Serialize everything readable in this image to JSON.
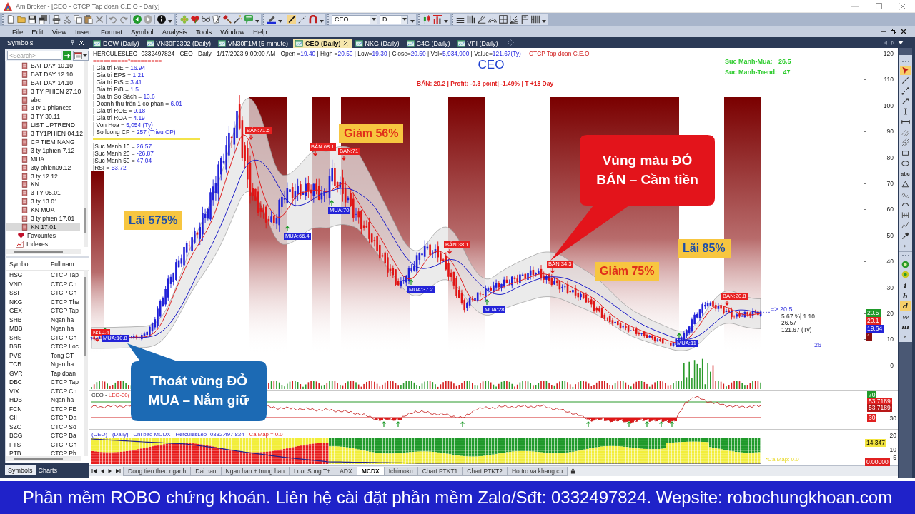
{
  "window": {
    "title": "AmiBroker - [CEO - CTCP Tap doan C.E.O - Daily]"
  },
  "toolbar": {
    "symbol_combo": "CEO",
    "interval_combo": "D"
  },
  "menu": [
    "File",
    "Edit",
    "View",
    "Insert",
    "Format",
    "Symbol",
    "Analysis",
    "Tools",
    "Window",
    "Help"
  ],
  "symbols_panel": {
    "title": "Symbols",
    "search": {
      "placeholder": "<Search>"
    },
    "tree": [
      {
        "label": "BAT DAY 10.10",
        "kind": "watchlist",
        "selected": false
      },
      {
        "label": "BAT DAY 12.10",
        "kind": "watchlist",
        "selected": false
      },
      {
        "label": "BAT DAY 14.10",
        "kind": "watchlist",
        "selected": false
      },
      {
        "label": "3 TY PHIEN 27.10",
        "kind": "watchlist",
        "selected": false
      },
      {
        "label": "abc",
        "kind": "watchlist",
        "selected": false
      },
      {
        "label": "3 ty 1 phienccc",
        "kind": "watchlist",
        "selected": false
      },
      {
        "label": "3 TY 30.11",
        "kind": "watchlist",
        "selected": false
      },
      {
        "label": "LIST UPTREND",
        "kind": "watchlist",
        "selected": false
      },
      {
        "label": "3 TY1PHIEN 04.12",
        "kind": "watchlist",
        "selected": false
      },
      {
        "label": "CP TIEM NANG",
        "kind": "watchlist",
        "selected": false
      },
      {
        "label": "3 ty 1phien 7.12",
        "kind": "watchlist",
        "selected": false
      },
      {
        "label": "MUA",
        "kind": "watchlist",
        "selected": false
      },
      {
        "label": "3ty phien09.12",
        "kind": "watchlist",
        "selected": false
      },
      {
        "label": "3 ty 12.12",
        "kind": "watchlist",
        "selected": false
      },
      {
        "label": "KN",
        "kind": "watchlist",
        "selected": false
      },
      {
        "label": "3 TY 05.01",
        "kind": "watchlist",
        "selected": false
      },
      {
        "label": "3 ty 13.01",
        "kind": "watchlist",
        "selected": false
      },
      {
        "label": "KN MUA",
        "kind": "watchlist",
        "selected": false
      },
      {
        "label": "3 ty phien 17.01",
        "kind": "watchlist",
        "selected": false
      },
      {
        "label": "KN 17.01",
        "kind": "watchlist",
        "selected": true
      },
      {
        "label": "Favourites",
        "kind": "favourites",
        "selected": false
      },
      {
        "label": "Indexes",
        "kind": "indexes",
        "selected": false
      }
    ],
    "table": {
      "columns": [
        "Symbol",
        "Full nam"
      ],
      "rows": [
        [
          "HSG",
          "CTCP Tap"
        ],
        [
          "VND",
          "CTCP Ch"
        ],
        [
          "SSI",
          "CTCP Ch"
        ],
        [
          "NKG",
          "CTCP The"
        ],
        [
          "GEX",
          "CTCP Tap"
        ],
        [
          "SHB",
          "Ngan ha"
        ],
        [
          "MBB",
          "Ngan ha"
        ],
        [
          "SHS",
          "CTCP Ch"
        ],
        [
          "BSR",
          "CTCP Loc"
        ],
        [
          "PVS",
          "Tong CT"
        ],
        [
          "TCB",
          "Ngan ha"
        ],
        [
          "GVR",
          "Tap doan"
        ],
        [
          "DBC",
          "CTCP Tap"
        ],
        [
          "VIX",
          "CTCP Ch"
        ],
        [
          "HDB",
          "Ngan ha"
        ],
        [
          "FCN",
          "CTCP FE"
        ],
        [
          "CII",
          "CTCP Da"
        ],
        [
          "SZC",
          "CTCP So"
        ],
        [
          "BCG",
          "CTCP Ba"
        ],
        [
          "FTS",
          "CTCP Ch"
        ],
        [
          "PTB",
          "CTCP Ph"
        ]
      ]
    },
    "tabs": [
      {
        "label": "Symbols",
        "selected": true
      },
      {
        "label": "Charts",
        "selected": false
      }
    ]
  },
  "chart_tabs": [
    {
      "label": "DGW (Daily)",
      "selected": false
    },
    {
      "label": "VN30F2302 (Daily)",
      "selected": false
    },
    {
      "label": "VN30F1M (5-minute)",
      "selected": false
    },
    {
      "label": "CEO (Daily)",
      "selected": true
    },
    {
      "label": "NKG (Daily)",
      "selected": false
    },
    {
      "label": "C4G (Daily)",
      "selected": false
    },
    {
      "label": "VPI (Daily)",
      "selected": false
    }
  ],
  "price_chart": {
    "header": [
      {
        "text": "HERCULESLEO -0332497824 - CEO - Daily - 1/17/2023 9:00:00 AM - Open =",
        "kind": "label"
      },
      {
        "text": "19.40",
        "kind": "value"
      },
      {
        "text": " | High =",
        "kind": "label"
      },
      {
        "text": "20.50",
        "kind": "value"
      },
      {
        "text": " | Low=",
        "kind": "label"
      },
      {
        "text": "19.30",
        "kind": "value"
      },
      {
        "text": " | Close=",
        "kind": "label"
      },
      {
        "text": "20.50",
        "kind": "value"
      },
      {
        "text": " | Vol=",
        "kind": "label"
      },
      {
        "text": "5,934,900",
        "kind": "value"
      },
      {
        "text": " | Value=",
        "kind": "label"
      },
      {
        "text": "121.67(Ty)",
        "kind": "value"
      },
      {
        "text": "----CTCP Tap doan C.E.O----",
        "kind": "name"
      }
    ],
    "separator": "==========*=========",
    "fundamentals": [
      {
        "label": "| Gia tri P/E = ",
        "value": "16.94"
      },
      {
        "label": "| Gia tri EPS = ",
        "value": "1.21"
      },
      {
        "label": "| Gia tri P/S = ",
        "value": "3.41"
      },
      {
        "label": "| Gia tri P/B = ",
        "value": "1.5"
      },
      {
        "label": "| Gia tri So Sách = ",
        "value": "13.6"
      },
      {
        "label": "| Doanh thu trên 1 co phan = ",
        "value": "6.01"
      },
      {
        "label": "| Gia tri ROE = ",
        "value": "9.18"
      },
      {
        "label": "| Gia tri ROA = ",
        "value": "4.19"
      },
      {
        "label": "| Von Hoa = ",
        "value": "5,054 (Ty)"
      },
      {
        "label": "| So luong CP = ",
        "value": "257 (Trieu CP)"
      }
    ],
    "strength": [
      {
        "label": "|Suc Manh 10 = ",
        "value": "26.57"
      },
      {
        "label": "|Suc Manh 20 = ",
        "value": "-26.87"
      },
      {
        "label": "|Suc Manh 50 = ",
        "value": "47.04"
      },
      {
        "label": "|RSI = ",
        "value": "53.72"
      }
    ],
    "title": "CEO",
    "trade_line": "BÁN: 20.2 | Profit: -0.3 point| -1.49% | T +18 Day",
    "summary": [
      {
        "label": "Suc Manh-Mua:",
        "value": "26.5"
      },
      {
        "label": "Suc Manh-Trend:",
        "value": "47"
      }
    ],
    "signals": [
      {
        "text": "N:10.4",
        "kind": "sell"
      },
      {
        "text": "MUA:10.8",
        "kind": "buy"
      },
      {
        "text": "BÁN:71.5",
        "kind": "sell"
      },
      {
        "text": "MUA:66.4",
        "kind": "buy"
      },
      {
        "text": "BÁN:68.1",
        "kind": "sell"
      },
      {
        "text": "MUA:70",
        "kind": "buy"
      },
      {
        "text": "BÁN:71",
        "kind": "sell"
      },
      {
        "text": "MUA:37.2",
        "kind": "buy"
      },
      {
        "text": "BÁN:38.1",
        "kind": "sell"
      },
      {
        "text": "MUA:28",
        "kind": "buy"
      },
      {
        "text": "BÁN:34.3",
        "kind": "sell"
      },
      {
        "text": "MUA:11",
        "kind": "buy"
      },
      {
        "text": "BÁN:20.8",
        "kind": "sell"
      }
    ],
    "highlights": [
      {
        "text": "Lãi 575%",
        "kind": "gain"
      },
      {
        "text": "Giảm 56%",
        "kind": "loss"
      },
      {
        "text": "Giảm 75%",
        "kind": "loss"
      },
      {
        "text": "Lãi 85%",
        "kind": "gain"
      }
    ],
    "readout": [
      {
        "text": "=> 20.5",
        "kind": "price"
      },
      {
        "text": "5.67 %| 1.10",
        "kind": "stat"
      },
      {
        "text": "26.57",
        "kind": "stat"
      },
      {
        "text": "121.67 (Ty)",
        "kind": "stat"
      }
    ],
    "marker_value": "26",
    "axis_labels": [
      "120",
      "110",
      "100",
      "90",
      "80",
      "70",
      "60",
      "50",
      "40",
      "30",
      "20",
      "10",
      "0"
    ],
    "price_tags": [
      {
        "text": "20.5",
        "color": "#1f9a2a"
      },
      {
        "text": "20.1",
        "color": "#e02020"
      },
      {
        "text": "19.64",
        "color": "#2424d8"
      },
      {
        "text": "1",
        "color": "#8b1010"
      }
    ]
  },
  "callouts": [
    {
      "lines": [
        "Vùng màu ĐỎ",
        "BÁN – Cầm tiền"
      ],
      "kind": "sell"
    },
    {
      "lines": [
        "Thoát vùng ĐỎ",
        "MUA – Nắm giữ"
      ],
      "kind": "buy"
    }
  ],
  "oscillator_pane": {
    "title": [
      {
        "text": "CEO - ",
        "kind": "symbol"
      },
      {
        "text": "LEO-30(",
        "kind": "indicator"
      }
    ],
    "tags": [
      {
        "text": "70",
        "color": "#1f9a2a"
      },
      {
        "text": "53.7189",
        "color": "#e02020"
      },
      {
        "text": "53.7189",
        "color": "#b81818"
      },
      {
        "text": "30",
        "color": "#e02020"
      }
    ],
    "axis_labels": [
      "30"
    ]
  },
  "mcdx_pane": {
    "title": [
      {
        "text": "(CEO) - (Daily) - Chi bao MCDX - HerculesLeo -0332.497.824",
        "kind": "symbol"
      },
      {
        "text": " - Ca Map = 0.0 -",
        "kind": "indicator"
      }
    ],
    "axis_labels": [
      "20",
      "10",
      "5"
    ],
    "tags": [
      {
        "text": "14.347",
        "color": "#f2e440"
      },
      {
        "text": "0.00000",
        "color": "#e02020"
      }
    ],
    "note": "*Ca Map: 0.0"
  },
  "sheet_tabs": [
    {
      "label": "Dong tien theo nganh",
      "selected": false
    },
    {
      "label": "Dai han",
      "selected": false
    },
    {
      "label": "Ngan han + trung han",
      "selected": false
    },
    {
      "label": "Luot Song T+",
      "selected": false
    },
    {
      "label": "ADX",
      "selected": false
    },
    {
      "label": "MCDX",
      "selected": true
    },
    {
      "label": "Ichimoku",
      "selected": false
    },
    {
      "label": "Chart PTKT1",
      "selected": false
    },
    {
      "label": "Chart PTKT2",
      "selected": false
    },
    {
      "label": "Ho tro va khang cu",
      "selected": false
    }
  ],
  "drawing_toolbar": {
    "pointer_selected": true,
    "text_tool": "abc",
    "letter_tools": [
      {
        "text": "i",
        "selected": false
      },
      {
        "text": "h",
        "selected": false
      },
      {
        "text": "d",
        "selected": true
      },
      {
        "text": "w",
        "selected": false
      },
      {
        "text": "m",
        "selected": false
      }
    ]
  },
  "banner": "Phần mềm ROBO chứng khoán. Liên hệ cài đặt phần mềm Zalo/Sđt: 0332497824. Wepsite: robochungkhoan.com"
}
